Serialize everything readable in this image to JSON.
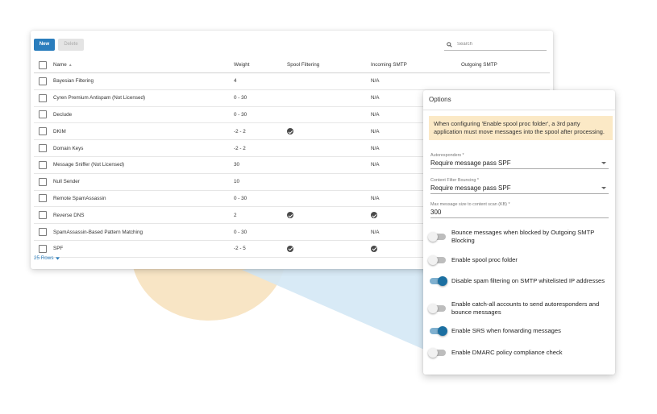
{
  "toolbar": {
    "new_label": "New",
    "delete_label": "Delete"
  },
  "search": {
    "placeholder": "Search"
  },
  "table": {
    "columns": [
      "Name",
      "Weight",
      "Spool Filtering",
      "Incoming SMTP",
      "Outgoing SMTP"
    ],
    "rows": [
      {
        "name": "Bayesian Filtering",
        "weight": "4",
        "spool": false,
        "incoming": "N/A"
      },
      {
        "name": "Cyren Premium Antispam (Not Licensed)",
        "weight": "0 - 30",
        "spool": false,
        "incoming": "N/A"
      },
      {
        "name": "Declude",
        "weight": "0 - 30",
        "spool": false,
        "incoming": "N/A"
      },
      {
        "name": "DKIM",
        "weight": "-2 - 2",
        "spool": true,
        "incoming": "N/A"
      },
      {
        "name": "Domain Keys",
        "weight": "-2 - 2",
        "spool": false,
        "incoming": "N/A"
      },
      {
        "name": "Message Sniffer (Not Licensed)",
        "weight": "30",
        "spool": false,
        "incoming": "N/A"
      },
      {
        "name": "Null Sender",
        "weight": "10",
        "spool": false,
        "incoming": ""
      },
      {
        "name": "Remote SpamAssassin",
        "weight": "0 - 30",
        "spool": false,
        "incoming": "N/A"
      },
      {
        "name": "Reverse DNS",
        "weight": "2",
        "spool": true,
        "incoming": "check"
      },
      {
        "name": "SpamAssassin-Based Pattern Matching",
        "weight": "0 - 30",
        "spool": false,
        "incoming": "N/A"
      },
      {
        "name": "SPF",
        "weight": "-2 - 5",
        "spool": true,
        "incoming": "check"
      }
    ],
    "rows_label": "25 Rows"
  },
  "options": {
    "title": "Options",
    "notice": "When configuring 'Enable spool proc folder', a 3rd party application must move messages into the spool after processing.",
    "autoresponders": {
      "label": "Autoresponders *",
      "value": "Require message pass SPF"
    },
    "content_filter": {
      "label": "Content Filter Bouncing *",
      "value": "Require message pass SPF"
    },
    "max_size": {
      "label": "Max message size to content scan (KB) *",
      "value": "300"
    },
    "toggles": [
      {
        "label": "Bounce messages when blocked by Outgoing SMTP Blocking",
        "on": false
      },
      {
        "label": "Enable spool proc folder",
        "on": false
      },
      {
        "label": "Disable spam filtering on SMTP whitelisted IP addresses",
        "on": true
      },
      {
        "label": "Enable catch-all accounts to send autoresponders and bounce messages",
        "on": false
      },
      {
        "label": "Enable SRS when forwarding messages",
        "on": true
      },
      {
        "label": "Enable DMARC policy compliance check",
        "on": false
      }
    ]
  },
  "colors": {
    "accent": "#2a7dbd",
    "toggle_on": "#1b6fa1",
    "notice_bg": "#fbe9c6"
  }
}
